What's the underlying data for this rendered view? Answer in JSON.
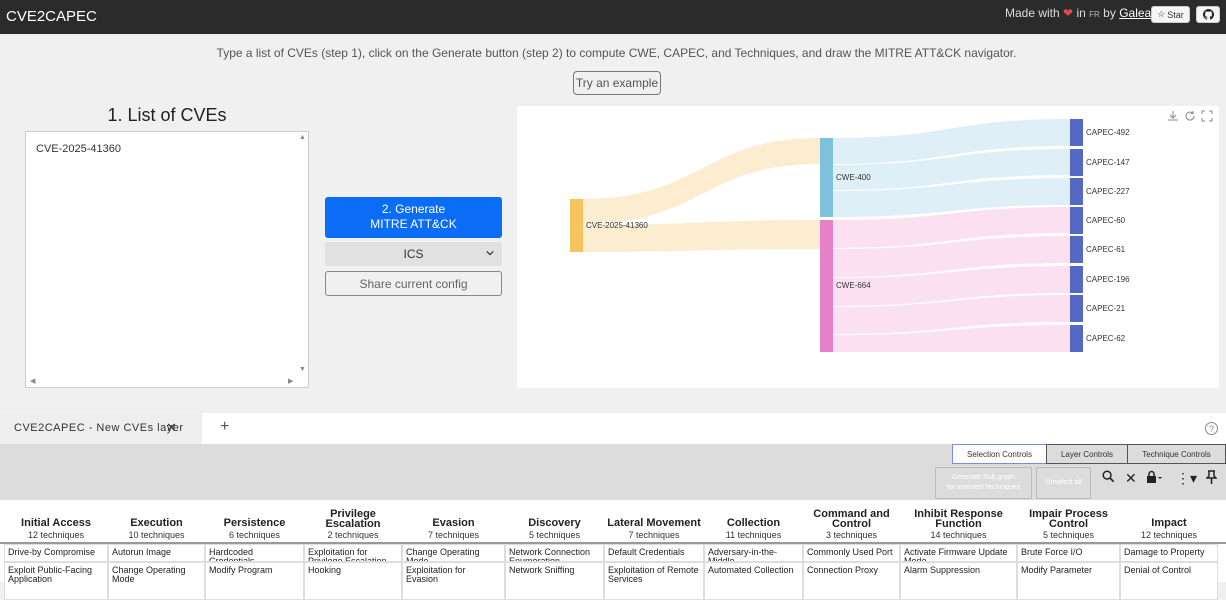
{
  "header": {
    "brand": "CVE2CAPEC",
    "made_with": "Made with",
    "in": "in",
    "fr": "FR",
    "by": "by",
    "author": "Galeax",
    "star": "Star"
  },
  "instructions": "Type a list of CVEs (step 1), click on the Generate button (step 2) to compute CWE, CAPEC, and Techniques, and draw the MITRE ATT&CK navigator.",
  "try_example": "Try an example",
  "cve_list": {
    "title": "1. List of CVEs",
    "value": "CVE-2025-41360"
  },
  "generate": {
    "line1": "2. Generate",
    "line2": "MITRE ATT&CK"
  },
  "domain_select": "ICS",
  "share": "Share current config",
  "sankey": {
    "cve": "CVE-2025-41360",
    "cwe": [
      "CWE-400",
      "CWE-664"
    ],
    "capec": [
      "CAPEC-492",
      "CAPEC-147",
      "CAPEC-227",
      "CAPEC-60",
      "CAPEC-61",
      "CAPEC-196",
      "CAPEC-21",
      "CAPEC-62"
    ],
    "colors": {
      "cve": "#f5c45e",
      "cwe400": "#7ec1dc",
      "cwe664": "#e580c9",
      "capec": "#5468c4"
    }
  },
  "layer_tab": "CVE2CAPEC - New CVEs layer",
  "controls": {
    "tabs": [
      "Selection Controls",
      "Layer Controls",
      "Technique Controls"
    ],
    "gen_sub": [
      "Generate Sub graph",
      "for selected Techniques"
    ],
    "unselect": "Unselect all"
  },
  "tactics": [
    {
      "name": [
        "Initial Access"
      ],
      "count": "12",
      "unit": "techniques",
      "cells": [
        [
          "Drive-by Compromise"
        ],
        [
          "Exploit Public-Facing",
          "Application"
        ]
      ]
    },
    {
      "name": [
        "Execution"
      ],
      "count": "10",
      "unit": "techniques",
      "cells": [
        [
          "Autorun Image"
        ],
        [
          "Change Operating",
          "Mode"
        ]
      ]
    },
    {
      "name": [
        "Persistence"
      ],
      "count": "6",
      "unit": "techniques",
      "cells": [
        [
          "Hardcoded Credentials"
        ],
        [
          "Modify Program"
        ]
      ]
    },
    {
      "name": [
        "Privilege",
        "Escalation"
      ],
      "count": "2",
      "unit": "techniques",
      "cells": [
        [
          "Exploitation for",
          "Privilege Escalation"
        ],
        [
          "Hooking"
        ]
      ]
    },
    {
      "name": [
        "Evasion"
      ],
      "count": "7",
      "unit": "techniques",
      "cells": [
        [
          "Change Operating Mode"
        ],
        [
          "Exploitation for Evasion"
        ]
      ]
    },
    {
      "name": [
        "Discovery"
      ],
      "count": "5",
      "unit": "techniques",
      "cells": [
        [
          "Network Connection",
          "Enumeration"
        ],
        [
          "Network Sniffing"
        ]
      ]
    },
    {
      "name": [
        "Lateral Movement"
      ],
      "count": "7",
      "unit": "techniques",
      "cells": [
        [
          "Default Credentials"
        ],
        [
          "Exploitation of Remote",
          "Services"
        ]
      ]
    },
    {
      "name": [
        "Collection"
      ],
      "count": "11",
      "unit": "techniques",
      "cells": [
        [
          "Adversary-in-the-Middle"
        ],
        [
          "Automated Collection"
        ]
      ]
    },
    {
      "name": [
        "Command and",
        "Control"
      ],
      "count": "3",
      "unit": "techniques",
      "cells": [
        [
          "Commonly Used Port"
        ],
        [
          "Connection Proxy"
        ]
      ]
    },
    {
      "name": [
        "Inhibit Response",
        "Function"
      ],
      "count": "14",
      "unit": "techniques",
      "cells": [
        [
          "Activate Firmware Update",
          "Mode"
        ],
        [
          "Alarm Suppression"
        ]
      ]
    },
    {
      "name": [
        "Impair Process",
        "Control"
      ],
      "count": "5",
      "unit": "techniques",
      "cells": [
        [
          "Brute Force I/O"
        ],
        [
          "Modify Parameter"
        ]
      ]
    },
    {
      "name": [
        "Impact"
      ],
      "count": "12",
      "unit": "techniques",
      "cells": [
        [
          "Damage to Property"
        ],
        [
          "Denial of Control"
        ]
      ]
    }
  ]
}
